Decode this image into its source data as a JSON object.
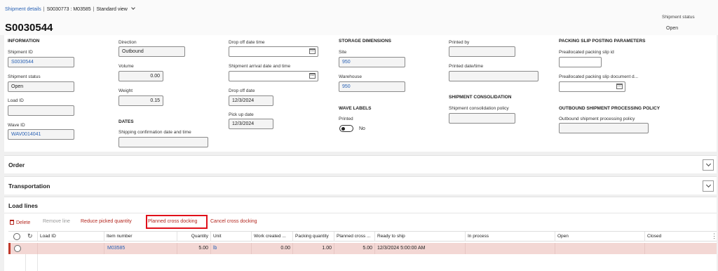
{
  "breadcrumb": {
    "page": "Shipment details",
    "record": "S0030773 : M03585",
    "view": "Standard view"
  },
  "header": {
    "title": "S0030544",
    "status_label": "Shipment status",
    "status_value": "Open"
  },
  "information": {
    "section": "INFORMATION",
    "shipment_id_label": "Shipment ID",
    "shipment_id": "S0030544",
    "shipment_status_label": "Shipment status",
    "shipment_status": "Open",
    "load_id_label": "Load ID",
    "load_id": "",
    "wave_id_label": "Wave ID",
    "wave_id": "WAV0014041",
    "direction_label": "Direction",
    "direction": "Outbound",
    "volume_label": "Volume",
    "volume": "0.00",
    "weight_label": "Weight",
    "weight": "0.15"
  },
  "dates": {
    "section": "DATES",
    "shipping_confirmation_label": "Shipping confirmation date and time",
    "shipping_confirmation": "",
    "drop_off_dt_label": "Drop off date time",
    "drop_off_dt": "",
    "arrival_label": "Shipment arrival date and time",
    "arrival": "",
    "drop_off_date_label": "Drop off date",
    "drop_off_date": "12/3/2024",
    "pick_up_date_label": "Pick up date",
    "pick_up_date": "12/3/2024"
  },
  "storage": {
    "section": "STORAGE DIMENSIONS",
    "site_label": "Site",
    "site": "950",
    "warehouse_label": "Warehouse",
    "warehouse": "950"
  },
  "wave_labels": {
    "section": "WAVE LABELS",
    "printed_label": "Printed",
    "printed_value": "No"
  },
  "printing": {
    "printed_by_label": "Printed by",
    "printed_by": "",
    "printed_dt_label": "Printed date/time",
    "printed_dt": ""
  },
  "consolidation": {
    "section": "SHIPMENT CONSOLIDATION",
    "policy_label": "Shipment consolidation policy",
    "policy": ""
  },
  "packing_slip": {
    "section": "PACKING SLIP POSTING PARAMETERS",
    "preallocated_id_label": "Preallocated packing slip id",
    "preallocated_id": "",
    "preallocated_date_label": "Preallocated packing slip document d...",
    "preallocated_date": ""
  },
  "outbound_policy": {
    "section": "OUTBOUND SHIPMENT PROCESSING POLICY",
    "policy_label": "Outbound shipment processing policy",
    "policy": ""
  },
  "fasttabs": {
    "order": "Order",
    "transportation": "Transportation",
    "load_lines": "Load lines"
  },
  "toolbar": {
    "delete": "Delete",
    "remove_line": "Remove line",
    "reduce_picked": "Reduce picked quantity",
    "planned_cross_docking": "Planned cross docking",
    "cancel_cross_docking": "Cancel cross docking"
  },
  "grid": {
    "columns": {
      "load_id": "Load ID",
      "item_number": "Item number",
      "quantity": "Quantity",
      "unit": "Unit",
      "work_created": "Work created ...",
      "packing_quantity": "Packing quantity",
      "planned_cross": "Planned cross ...",
      "ready_to_ship": "Ready to ship",
      "in_process": "In process",
      "open": "Open",
      "closed": "Closed"
    },
    "rows": [
      {
        "load_id": "",
        "item_number": "M03585",
        "quantity": "5.00",
        "unit": "lb",
        "work_created": "0.00",
        "packing_quantity": "1.00",
        "planned_cross": "5.00",
        "ready_to_ship": "12/3/2024 5:00:00 AM",
        "in_process": "",
        "open": "",
        "closed": ""
      }
    ]
  },
  "colors": {
    "accent": "#2b63b5",
    "action_red": "#b3261e",
    "highlight_border": "#e0101a",
    "selected_row": "#f3d7d4"
  }
}
